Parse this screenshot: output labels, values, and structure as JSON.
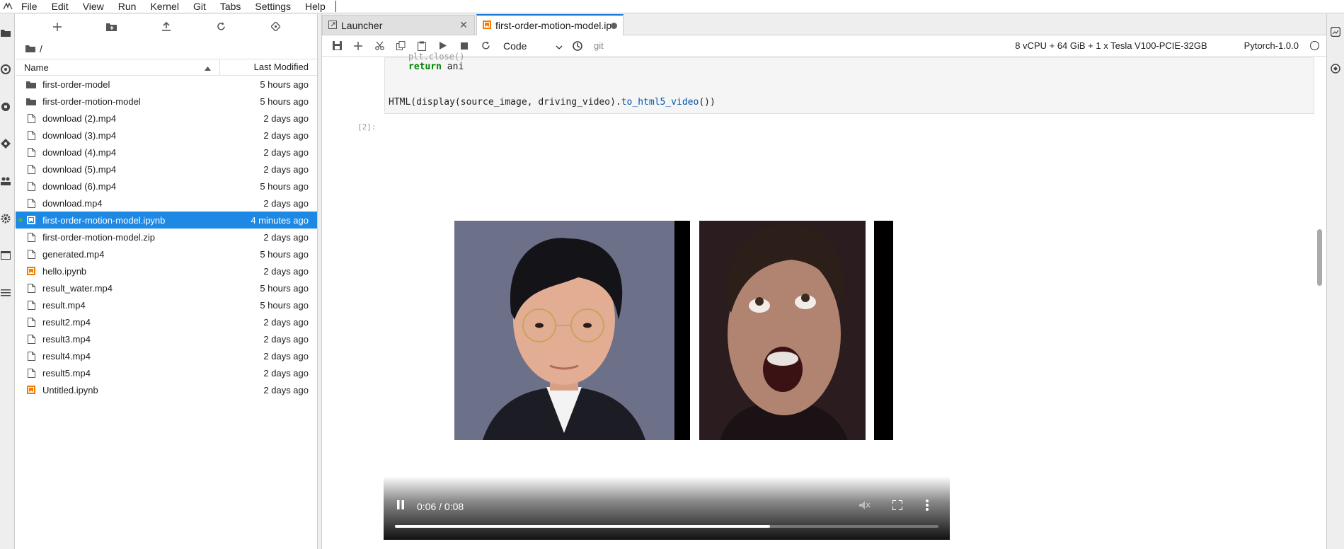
{
  "menubar": {
    "items": [
      "File",
      "Edit",
      "View",
      "Run",
      "Kernel",
      "Git",
      "Tabs",
      "Settings",
      "Help"
    ]
  },
  "filebrowser": {
    "path": "/",
    "columns": {
      "name": "Name",
      "modified": "Last Modified"
    },
    "files": [
      {
        "name": "first-order-model",
        "modified": "5 hours ago",
        "type": "folder"
      },
      {
        "name": "first-order-motion-model",
        "modified": "5 hours ago",
        "type": "folder"
      },
      {
        "name": "download (2).mp4",
        "modified": "2 days ago",
        "type": "file"
      },
      {
        "name": "download (3).mp4",
        "modified": "2 days ago",
        "type": "file"
      },
      {
        "name": "download (4).mp4",
        "modified": "2 days ago",
        "type": "file"
      },
      {
        "name": "download (5).mp4",
        "modified": "2 days ago",
        "type": "file"
      },
      {
        "name": "download (6).mp4",
        "modified": "5 hours ago",
        "type": "file"
      },
      {
        "name": "download.mp4",
        "modified": "2 days ago",
        "type": "file"
      },
      {
        "name": "first-order-motion-model.ipynb",
        "modified": "4 minutes ago",
        "type": "notebook-selected"
      },
      {
        "name": "first-order-motion-model.zip",
        "modified": "2 days ago",
        "type": "file"
      },
      {
        "name": "generated.mp4",
        "modified": "5 hours ago",
        "type": "file"
      },
      {
        "name": "hello.ipynb",
        "modified": "2 days ago",
        "type": "notebook"
      },
      {
        "name": "result_water.mp4",
        "modified": "5 hours ago",
        "type": "file"
      },
      {
        "name": "result.mp4",
        "modified": "5 hours ago",
        "type": "file"
      },
      {
        "name": "result2.mp4",
        "modified": "2 days ago",
        "type": "file"
      },
      {
        "name": "result3.mp4",
        "modified": "2 days ago",
        "type": "file"
      },
      {
        "name": "result4.mp4",
        "modified": "2 days ago",
        "type": "file"
      },
      {
        "name": "result5.mp4",
        "modified": "2 days ago",
        "type": "file"
      },
      {
        "name": "Untitled.ipynb",
        "modified": "2 days ago",
        "type": "notebook"
      }
    ]
  },
  "tabs": {
    "launcher": "Launcher",
    "notebook": "first-order-motion-model.ipynb"
  },
  "notebook_toolbar": {
    "cell_type": "Code",
    "git": "git",
    "resources": "8 vCPU + 64 GiB + 1 x Tesla V100-PCIE-32GB",
    "kernel": "Pytorch-1.0.0"
  },
  "cell": {
    "line_partial": "plt.close()",
    "line1_kw": "return",
    "line1_rest": " ani",
    "line2_a": "HTML(display(source_image, driving_video).",
    "line2_fn": "to_html5_video",
    "line2_b": "())",
    "out_prompt": "[2]:"
  },
  "video": {
    "time": "0:06 / 0:08",
    "progress": 0.69
  },
  "colors": {
    "selection": "#1e88e5",
    "accent": "#1976d2",
    "notebook_icon": "#f57c00"
  }
}
